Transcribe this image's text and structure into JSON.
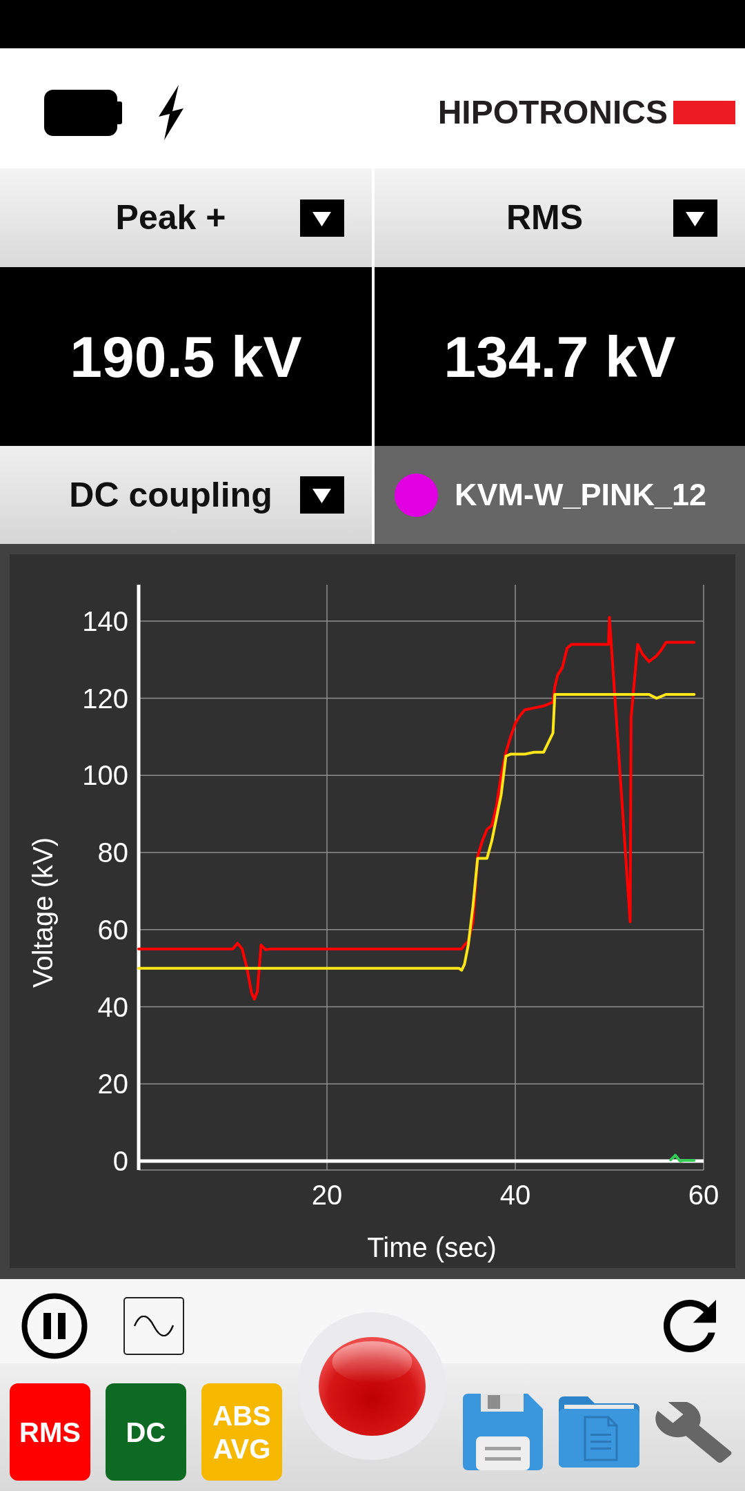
{
  "header": {
    "logo": "HIPOTRONICS"
  },
  "measurements": [
    {
      "label": "Peak +",
      "value": "190.5 kV"
    },
    {
      "label": "RMS",
      "value": "134.7 kV"
    }
  ],
  "coupling": {
    "label": "DC coupling"
  },
  "probe": {
    "name": "KVM-W_PINK_12",
    "color": "#e100e1"
  },
  "chart": {
    "chart_data": {
      "type": "line",
      "xlabel": "Time (sec)",
      "ylabel": "Voltage (kV)",
      "x": [
        0,
        5,
        10,
        10.5,
        11,
        11.5,
        12,
        12.3,
        12.6,
        13,
        13.5,
        14,
        15,
        20,
        25,
        30,
        34,
        34.3,
        34.6,
        35,
        35.5,
        36,
        36.5,
        37,
        37.5,
        38,
        38.5,
        39,
        39.5,
        40,
        40.5,
        41,
        42,
        43,
        44,
        44.2,
        44.5,
        45,
        45.5,
        46,
        48,
        49.9,
        50,
        52.2,
        52.3,
        53,
        53.5,
        54.2,
        55,
        55.5,
        56,
        56.5,
        57,
        57.5,
        58,
        59
      ],
      "series": [
        {
          "color": "#ff0000",
          "values": [
            55,
            55,
            55,
            56.5,
            55,
            50,
            43.5,
            42,
            44,
            56,
            54.8,
            55,
            55,
            55,
            55,
            55,
            55,
            55,
            56,
            57,
            62,
            79,
            83,
            86,
            87,
            92,
            100,
            106,
            110,
            113.5,
            115.5,
            117,
            117.5,
            118,
            119,
            123,
            126,
            128,
            133,
            134,
            134,
            134,
            141,
            62,
            115,
            134,
            131.5,
            129.5,
            131,
            132.5,
            134.5,
            134.5,
            134.5,
            134.5,
            134.5,
            134.5
          ]
        },
        {
          "color": "#ffe619",
          "values": [
            50,
            50,
            50,
            50,
            50,
            50,
            50,
            50,
            50,
            50,
            50,
            50,
            50,
            50,
            50,
            50,
            50,
            49.5,
            51,
            56,
            66,
            78.5,
            78.5,
            78.5,
            83,
            89,
            95,
            105,
            105.5,
            105.5,
            105.5,
            105.5,
            106,
            106,
            111,
            121,
            121,
            121,
            121,
            121,
            121,
            121,
            121,
            121,
            121,
            121,
            121,
            121,
            120,
            120.5,
            121,
            121,
            121,
            121,
            121,
            121
          ]
        },
        {
          "color": "#33cc55",
          "values": [
            null,
            null,
            null,
            null,
            null,
            null,
            null,
            null,
            null,
            null,
            null,
            null,
            null,
            null,
            null,
            null,
            null,
            null,
            null,
            null,
            null,
            null,
            null,
            null,
            null,
            null,
            null,
            null,
            null,
            null,
            null,
            null,
            null,
            null,
            null,
            null,
            null,
            null,
            null,
            null,
            null,
            null,
            null,
            null,
            null,
            null,
            null,
            null,
            null,
            null,
            null,
            0.3,
            1.5,
            0,
            0.2,
            0.2
          ]
        }
      ],
      "xlim": [
        0,
        60
      ],
      "ylim": [
        0,
        150
      ],
      "xticks": [
        20,
        40,
        60
      ],
      "yticks": [
        0,
        20,
        40,
        60,
        80,
        100,
        120,
        140
      ],
      "grid": true
    }
  },
  "modes": [
    {
      "label": "RMS",
      "color": "#ff0000"
    },
    {
      "label": "DC",
      "color": "#0d6a22"
    },
    {
      "label": "ABS AVG",
      "color": "#f6b800"
    }
  ]
}
